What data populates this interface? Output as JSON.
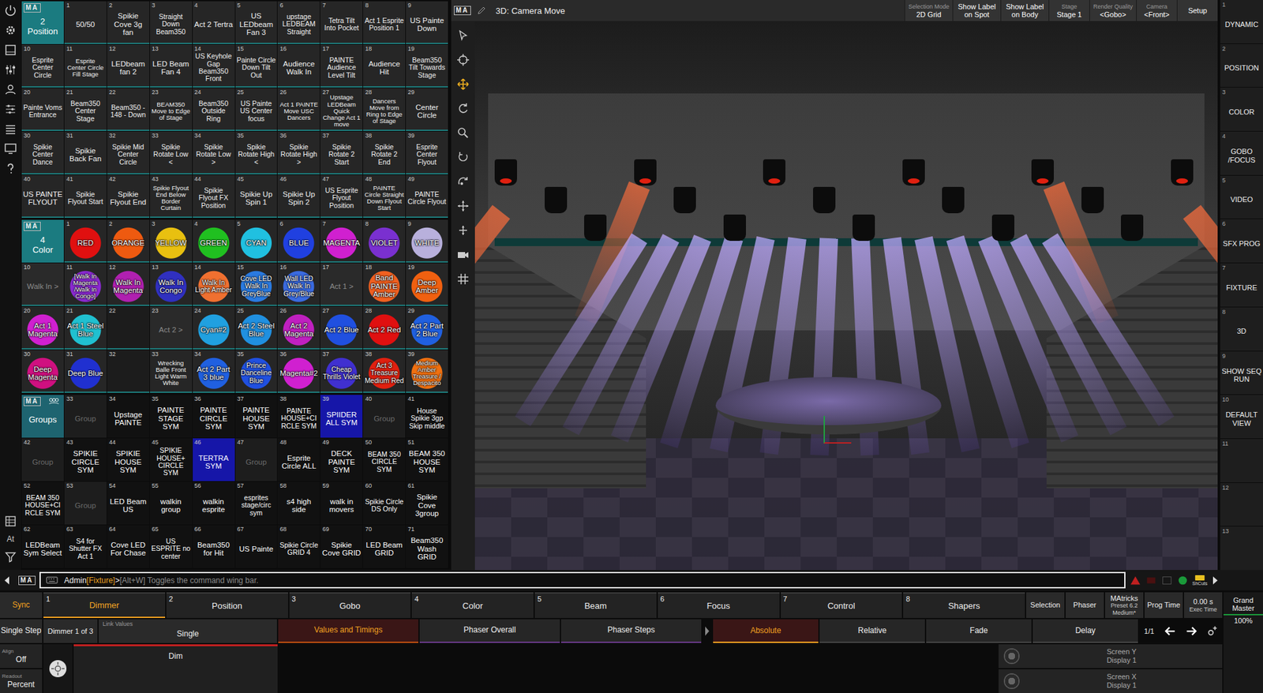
{
  "left_toolbar": {
    "at_label": "At"
  },
  "pools": [
    {
      "kind": "position",
      "logo": "MA",
      "number": "2",
      "title": "Position",
      "items": [
        {
          "number": "1",
          "label": "50/50"
        },
        {
          "number": "2",
          "label": "Spikie Cove 3g fan"
        },
        {
          "number": "3",
          "label": "Straight Down Beam350"
        },
        {
          "number": "4",
          "label": "Act 2 Tertra"
        },
        {
          "number": "5",
          "label": "US LEDbeam Fan 3"
        },
        {
          "number": "6",
          "label": "upstage LEDBEAM Straight"
        },
        {
          "number": "7",
          "label": "Tetra Tilt Into Pocket"
        },
        {
          "number": "8",
          "label": "Act 1 Esprite Position 1"
        },
        {
          "number": "9",
          "label": "US Painte Down"
        },
        {
          "number": "10",
          "label": "Esprite Center Circle"
        },
        {
          "number": "11",
          "label": "Esprite Center Circle Fill Stage"
        },
        {
          "number": "12",
          "label": "LEDbeam fan 2"
        },
        {
          "number": "13",
          "label": "LED Beam Fan 4"
        },
        {
          "number": "14",
          "label": "US Keyhole Gap Beam350 Front"
        },
        {
          "number": "15",
          "label": "Painte Circle Down Tilt Out"
        },
        {
          "number": "16",
          "label": "Audience Walk In"
        },
        {
          "number": "17",
          "label": "PAINTE Audience Level Tilt"
        },
        {
          "number": "18",
          "label": "Audience Hit"
        },
        {
          "number": "19",
          "label": "Beam350 Tilt Towards Stage"
        },
        {
          "number": "20",
          "label": "Painte Voms Entrance"
        },
        {
          "number": "21",
          "label": "Beam350 Center Stage"
        },
        {
          "number": "22",
          "label": "Beam350 - 148 - Down"
        },
        {
          "number": "23",
          "label": "BEAM350 Move to Edge of Stage"
        },
        {
          "number": "24",
          "label": "Beam350 Outside Ring"
        },
        {
          "number": "25",
          "label": "US Painte US Center focus"
        },
        {
          "number": "26",
          "label": "Act 1 PAINTE Move USC Dancers"
        },
        {
          "number": "27",
          "label": "Upstage LEDBeam Quick Change Act 1 move"
        },
        {
          "number": "28",
          "label": "Dancers Move from Ring to Edge of Stage"
        },
        {
          "number": "29",
          "label": "Center Circle"
        },
        {
          "number": "30",
          "label": "Spikie Center Dance"
        },
        {
          "number": "31",
          "label": "Spikie Back Fan"
        },
        {
          "number": "32",
          "label": "Spikie Mid Center Circle"
        },
        {
          "number": "33",
          "label": "Spikie Rotate Low <"
        },
        {
          "number": "34",
          "label": "Spikie Rotate Low >"
        },
        {
          "number": "35",
          "label": "Spikie Rotate High <"
        },
        {
          "number": "36",
          "label": "Spikie Rotate High >"
        },
        {
          "number": "37",
          "label": "Spikie Rotate 2 Start"
        },
        {
          "number": "38",
          "label": "Spikie Rotate 2 End"
        },
        {
          "number": "39",
          "label": "Esprite Center Flyout"
        },
        {
          "number": "40",
          "label": "US PAINTE FLYOUT"
        },
        {
          "number": "41",
          "label": "Spikie Flyout Start"
        },
        {
          "number": "42",
          "label": "Spikie Flyout End"
        },
        {
          "number": "43",
          "label": "Spikie Flyout End Below Border Curtain"
        },
        {
          "number": "44",
          "label": "Spikie Flyout FX Position"
        },
        {
          "number": "45",
          "label": "Spikie Up Spin 1"
        },
        {
          "number": "46",
          "label": "Spikie Up Spin 2"
        },
        {
          "number": "47",
          "label": "US Esprite Flyout Position"
        },
        {
          "number": "48",
          "label": "PAINTE Circle Straight Down Flyout Start"
        },
        {
          "number": "49",
          "label": "PAINTE Circle Flyout"
        }
      ]
    },
    {
      "kind": "color",
      "logo": "MA",
      "number": "4",
      "title": "Color",
      "items": [
        {
          "number": "1",
          "label": "RED",
          "kind": "swatch",
          "color": "#e01010"
        },
        {
          "number": "2",
          "label": "ORANGE",
          "kind": "swatch",
          "color": "#ee5a10"
        },
        {
          "number": "3",
          "label": "YELLOW",
          "kind": "swatch",
          "color": "#e8c010"
        },
        {
          "number": "4",
          "label": "GREEN",
          "kind": "swatch",
          "color": "#20c020"
        },
        {
          "number": "5",
          "label": "CYAN",
          "kind": "swatch",
          "color": "#20c0e0"
        },
        {
          "number": "6",
          "label": "BLUE",
          "kind": "swatch",
          "color": "#2040e0"
        },
        {
          "number": "7",
          "label": "MAGENTA",
          "kind": "swatch",
          "color": "#d020d0"
        },
        {
          "number": "8",
          "label": "VIOLET",
          "kind": "swatch",
          "color": "#7a30d0"
        },
        {
          "number": "9",
          "label": "WHITE",
          "kind": "swatch",
          "color": "#b8b0dc"
        },
        {
          "number": "10",
          "label": "Walk In >",
          "kind": "separator"
        },
        {
          "number": "11",
          "label": "[Walk In Magenta /Walk In Congo]",
          "kind": "swatch",
          "color": "#8a2ad0"
        },
        {
          "number": "12",
          "label": "Walk In Magenta",
          "kind": "swatch",
          "color": "#b020b0"
        },
        {
          "number": "13",
          "label": "Walk In Congo",
          "kind": "swatch",
          "color": "#3030c0"
        },
        {
          "number": "14",
          "label": "Walk In Light Amber",
          "kind": "swatch",
          "color": "#f07030"
        },
        {
          "number": "15",
          "label": "Cove LED Walk In GreyBlue",
          "kind": "swatch",
          "color": "#2a7ae0"
        },
        {
          "number": "16",
          "label": "Wall LED Walk In Grey/Blue",
          "kind": "swatch",
          "color": "#3a6ae0"
        },
        {
          "number": "17",
          "label": "Act 1 >",
          "kind": "separator"
        },
        {
          "number": "18",
          "label": "Band PAINTE Amber",
          "kind": "swatch",
          "color": "#f06020"
        },
        {
          "number": "19",
          "label": "Deep Amber",
          "kind": "swatch",
          "color": "#f06010"
        },
        {
          "number": "20",
          "label": "Act 1 Magenta",
          "kind": "swatch",
          "color": "#d020d0"
        },
        {
          "number": "21",
          "label": "Act 1 Steel Blue",
          "kind": "swatch",
          "color": "#20c0d0"
        },
        {
          "number": "22",
          "label": "",
          "kind": "empty"
        },
        {
          "number": "23",
          "label": "Act 2 >",
          "kind": "separator"
        },
        {
          "number": "24",
          "label": "Cyan#2",
          "kind": "swatch",
          "color": "#20a0e0"
        },
        {
          "number": "25",
          "label": "Act 2 Steel Blue",
          "kind": "swatch",
          "color": "#2090e0"
        },
        {
          "number": "26",
          "label": "Act 2 Magenta",
          "kind": "swatch",
          "color": "#c020c0"
        },
        {
          "number": "27",
          "label": "Act 2 Blue",
          "kind": "swatch",
          "color": "#2050e0"
        },
        {
          "number": "28",
          "label": "Act 2 Red",
          "kind": "swatch",
          "color": "#e01010"
        },
        {
          "number": "29",
          "label": "Act 2 Part 2 Blue",
          "kind": "swatch",
          "color": "#2060e0"
        },
        {
          "number": "30",
          "label": "Deep Magenta",
          "kind": "swatch",
          "color": "#d01080"
        },
        {
          "number": "31",
          "label": "Deep Blue",
          "kind": "swatch",
          "color": "#2030d0"
        },
        {
          "number": "32",
          "label": "",
          "kind": "empty"
        },
        {
          "number": "33",
          "label": "Wrecking Balle Front Light Warm White",
          "kind": "plain"
        },
        {
          "number": "34",
          "label": "Act 2 Part 3 blue",
          "kind": "swatch",
          "color": "#2060e0"
        },
        {
          "number": "35",
          "label": "Prince Danceline Blue",
          "kind": "swatch",
          "color": "#2050e0"
        },
        {
          "number": "36",
          "label": "Magenta#2",
          "kind": "swatch",
          "color": "#d020d0"
        },
        {
          "number": "37",
          "label": "Cheap Thrills Violet",
          "kind": "swatch",
          "color": "#4030d0"
        },
        {
          "number": "38",
          "label": "Act 3 Treasure Medium Red",
          "kind": "swatch",
          "color": "#e02010"
        },
        {
          "number": "39",
          "label": "Medium Amber Treasure / Despacito",
          "kind": "swatch",
          "color": "#f07010"
        }
      ]
    },
    {
      "kind": "groups",
      "logo": "MA",
      "title": "Groups",
      "items": [
        {
          "number": "33",
          "label": "Group",
          "kind": "empty",
          "selected": false
        },
        {
          "number": "34",
          "label": "Upstage PAINTE",
          "kind": "group",
          "selected": false
        },
        {
          "number": "35",
          "label": "PAINTE STAGE SYM",
          "kind": "group",
          "selected": false
        },
        {
          "number": "36",
          "label": "PAINTE CIRCLE SYM",
          "kind": "group",
          "selected": false
        },
        {
          "number": "37",
          "label": "PAINTE HOUSE SYM",
          "kind": "group",
          "selected": false
        },
        {
          "number": "38",
          "label": "PAINTE HOUSE+CIRCLE SYM",
          "kind": "group",
          "selected": false
        },
        {
          "number": "39",
          "label": "SPIIDER ALL SYM",
          "kind": "group",
          "selected": true
        },
        {
          "number": "40",
          "label": "Group",
          "kind": "empty",
          "selected": false
        },
        {
          "number": "41",
          "label": "House Spikie 3gp Skip middle",
          "kind": "group",
          "selected": false
        },
        {
          "number": "42",
          "label": "Group",
          "kind": "empty",
          "selected": false
        },
        {
          "number": "43",
          "label": "SPIKIE CIRCLE SYM",
          "kind": "group",
          "selected": false
        },
        {
          "number": "44",
          "label": "SPIKIE HOUSE SYM",
          "kind": "group",
          "selected": false
        },
        {
          "number": "45",
          "label": "SPIKIE HOUSE+ CIRCLE SYM",
          "kind": "group",
          "selected": false
        },
        {
          "number": "46",
          "label": "TERTRA SYM",
          "kind": "group",
          "selected": true
        },
        {
          "number": "47",
          "label": "Group",
          "kind": "empty",
          "selected": false
        },
        {
          "number": "48",
          "label": "Esprite Circle ALL",
          "kind": "group",
          "selected": false
        },
        {
          "number": "49",
          "label": "DECK PAINTE SYM",
          "kind": "group",
          "selected": false
        },
        {
          "number": "50",
          "label": "BEAM 350 CIRCLE SYM",
          "kind": "group",
          "selected": false
        },
        {
          "number": "51",
          "label": "BEAM 350 HOUSE SYM",
          "kind": "group",
          "selected": false
        },
        {
          "number": "52",
          "label": "BEAM 350 HOUSE+CIRCLE SYM",
          "kind": "group",
          "selected": false
        },
        {
          "number": "53",
          "label": "Group",
          "kind": "empty",
          "selected": false
        },
        {
          "number": "54",
          "label": "LED Beam US",
          "kind": "group",
          "selected": false
        },
        {
          "number": "55",
          "label": "walkin group",
          "kind": "group",
          "selected": false
        },
        {
          "number": "56",
          "label": "walkin esprite",
          "kind": "group",
          "selected": false
        },
        {
          "number": "57",
          "label": "esprites stage/circ sym",
          "kind": "group",
          "selected": false
        },
        {
          "number": "58",
          "label": "s4 high side",
          "kind": "group",
          "selected": false
        },
        {
          "number": "59",
          "label": "walk in movers",
          "kind": "group",
          "selected": false
        },
        {
          "number": "60",
          "label": "Spikie Circle DS Only",
          "kind": "group",
          "selected": false
        },
        {
          "number": "61",
          "label": "Spikie Cove 3group",
          "kind": "group",
          "selected": false
        },
        {
          "number": "62",
          "label": "LEDBeam Sym Select",
          "kind": "group",
          "selected": false
        },
        {
          "number": "63",
          "label": "S4 for Shutter FX Act 1",
          "kind": "group",
          "selected": false
        },
        {
          "number": "64",
          "label": "Cove LED For Chase",
          "kind": "group",
          "selected": false
        },
        {
          "number": "65",
          "label": "US ESPRITE no center",
          "kind": "group",
          "selected": false
        },
        {
          "number": "66",
          "label": "Beam350 for Hit",
          "kind": "group",
          "selected": false
        },
        {
          "number": "67",
          "label": "US Painte",
          "kind": "group",
          "selected": false
        },
        {
          "number": "68",
          "label": "Spikie Circle GRID 4",
          "kind": "group",
          "selected": false
        },
        {
          "number": "69",
          "label": "Spikie Cove GRID",
          "kind": "group",
          "selected": false
        },
        {
          "number": "70",
          "label": "LED Beam GRID",
          "kind": "group",
          "selected": false
        },
        {
          "number": "71",
          "label": "Beam350 Wash GRID",
          "kind": "group",
          "selected": false
        }
      ]
    }
  ],
  "viewer": {
    "logo": "MA",
    "title": "3D: Camera Move",
    "controls": [
      {
        "label": "Selection Mode",
        "value": "2D Grid"
      },
      {
        "value": "Show Label on Spot"
      },
      {
        "value": "Show Label on Body"
      },
      {
        "label": "Stage",
        "value": "Stage 1"
      },
      {
        "label": "Render Quality",
        "value": "<Gobo>"
      },
      {
        "label": "Camera",
        "value": "<Front>"
      },
      {
        "value": "Setup"
      }
    ]
  },
  "sidebar": [
    {
      "number": "1",
      "label": "DYNAMIC"
    },
    {
      "number": "2",
      "label": "POSITION"
    },
    {
      "number": "3",
      "label": "COLOR"
    },
    {
      "number": "4",
      "label": "GOBO /FOCUS"
    },
    {
      "number": "5",
      "label": "VIDEO"
    },
    {
      "number": "6",
      "label": "SFX PROG"
    },
    {
      "number": "7",
      "label": "FIXTURE"
    },
    {
      "number": "8",
      "label": "3D"
    },
    {
      "number": "9",
      "label": "SHOW SEQ RUN"
    },
    {
      "number": "10",
      "label": "DEFAULT VIEW"
    },
    {
      "number": "11",
      "label": ""
    },
    {
      "number": "12",
      "label": ""
    },
    {
      "number": "13",
      "label": ""
    }
  ],
  "command_line": {
    "logo": "MA",
    "user": "Admin",
    "destination": "[Fixture]",
    "prompt": ">",
    "hint": "[Alt+W] Toggles the command wing bar.",
    "shortcuts": "ShCuts"
  },
  "preset_bar": {
    "sync": "Sync",
    "tabs": [
      {
        "number": "1",
        "label": "Dimmer",
        "selected": true
      },
      {
        "number": "2",
        "label": "Position",
        "selected": false
      },
      {
        "number": "3",
        "label": "Gobo",
        "selected": false
      },
      {
        "number": "4",
        "label": "Color",
        "selected": false
      },
      {
        "number": "5",
        "label": "Beam",
        "selected": false
      },
      {
        "number": "6",
        "label": "Focus",
        "selected": false
      },
      {
        "number": "7",
        "label": "Control",
        "selected": false
      },
      {
        "number": "8",
        "label": "Shapers",
        "selected": false
      }
    ],
    "buttons": [
      {
        "label": "Selection"
      },
      {
        "label": "Phaser"
      },
      {
        "label": "MAtricks",
        "sub": "Preset 6.2 Medium*"
      },
      {
        "label": "Prog Time"
      },
      {
        "label": "0.00 s",
        "sub": "Exec Time"
      }
    ]
  },
  "grand_master": {
    "label": "Grand Master",
    "value": "100%"
  },
  "mode_bar": {
    "single_step": "Single Step",
    "feature": "Dimmer 1 of 3",
    "link": {
      "label": "Link Values",
      "value": "Single"
    },
    "tabs": [
      {
        "label": "Values and Timings",
        "selected": true
      },
      {
        "label": "Phaser Overall",
        "selected": false
      },
      {
        "label": "Phaser Steps",
        "selected": false
      }
    ],
    "modes": [
      {
        "label": "Absolute",
        "selected": true
      },
      {
        "label": "Relative",
        "selected": false
      },
      {
        "label": "Fade",
        "selected": false
      },
      {
        "label": "Delay",
        "selected": false
      }
    ],
    "page": "1/1"
  },
  "encoder_bar": {
    "align": {
      "label": "Align",
      "value": "Off"
    },
    "readout": {
      "label": "Readout",
      "value": "Percent"
    },
    "attribute": "Dim",
    "screens": [
      {
        "label": "Screen Y",
        "value": "Display 1"
      },
      {
        "label": "Screen X",
        "value": "Display 1"
      }
    ]
  }
}
